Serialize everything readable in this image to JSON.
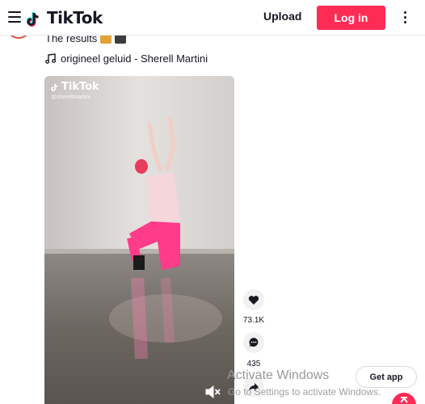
{
  "header": {
    "logo_text": "TikTok",
    "upload_label": "Upload",
    "login_label": "Log in"
  },
  "post": {
    "caption": "The results",
    "sound_label": "origineel geluid - Sherell Martini",
    "video": {
      "watermark_title": "TikTok",
      "watermark_user": "@sherellmartini"
    },
    "likes_count": "73.1K",
    "comments_count": "435"
  },
  "overlay": {
    "activate_title": "Activate Windows",
    "activate_subtitle": "Go to Settings to activate Windows.",
    "get_app_label": "Get app"
  },
  "colors": {
    "brand_red": "#fe2c55",
    "text_dark": "#161823"
  },
  "icons": [
    "menu-icon",
    "tiktok-note-icon",
    "more-vertical-icon",
    "music-note-icon",
    "heart-icon",
    "comment-icon",
    "share-icon",
    "mute-icon",
    "arrow-up-icon"
  ]
}
